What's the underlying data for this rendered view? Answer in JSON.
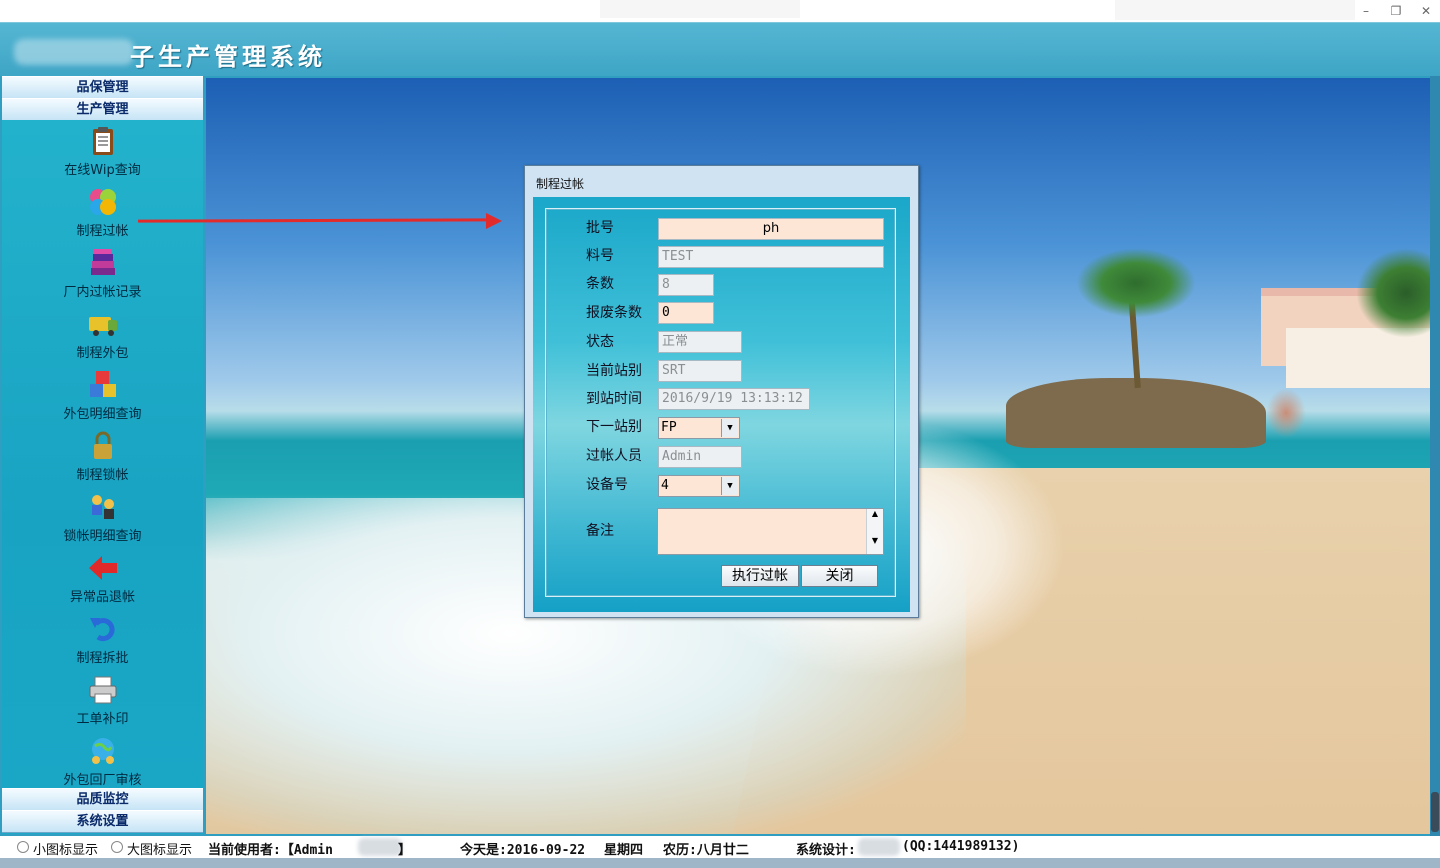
{
  "window": {
    "app_title": "子生产管理系统",
    "minimize": "–",
    "restore": "❐",
    "close": "✕"
  },
  "sidebar": {
    "top_sections": [
      "品保管理",
      "生产管理"
    ],
    "items": [
      {
        "label": "在线Wip查询",
        "icon": "clipboard-icon"
      },
      {
        "label": "制程过帐",
        "icon": "colorful-pinwheel-icon"
      },
      {
        "label": "厂内过帐记录",
        "icon": "books-icon"
      },
      {
        "label": "制程外包",
        "icon": "truck-icon"
      },
      {
        "label": "外包明细查询",
        "icon": "blocks-icon"
      },
      {
        "label": "制程锁帐",
        "icon": "padlock-icon"
      },
      {
        "label": "锁帐明细查询",
        "icon": "lock-users-icon"
      },
      {
        "label": "异常品退帐",
        "icon": "red-left-arrow-icon"
      },
      {
        "label": "制程拆批",
        "icon": "undo-arrow-icon"
      },
      {
        "label": "工单补印",
        "icon": "printer-icon"
      },
      {
        "label": "外包回厂审核",
        "icon": "globe-users-icon"
      }
    ],
    "bottom_sections": [
      "品质监控",
      "系统设置"
    ],
    "scroll_down": "▼"
  },
  "dialog": {
    "title": "制程过帐",
    "fields": {
      "batch": {
        "label": "批号",
        "value": "ph"
      },
      "material": {
        "label": "料号",
        "value": "TEST"
      },
      "count": {
        "label": "条数",
        "value": "8"
      },
      "scrap": {
        "label": "报废条数",
        "value": "0"
      },
      "status": {
        "label": "状态",
        "value": "正常"
      },
      "current_station": {
        "label": "当前站别",
        "value": "SRT"
      },
      "arrival_time": {
        "label": "到站时间",
        "value": "2016/9/19 13:13:12"
      },
      "next_station": {
        "label": "下一站别",
        "value": "FP"
      },
      "operator": {
        "label": "过帐人员",
        "value": "Admin"
      },
      "device": {
        "label": "设备号",
        "value": "4"
      },
      "remark": {
        "label": "备注",
        "value": ""
      }
    },
    "execute_button": "执行过帐",
    "close_button": "关闭"
  },
  "statusbar": {
    "small_icons": "小图标显示",
    "large_icons": "大图标显示",
    "current_user_label": "当前使用者:【Admin",
    "current_user_end": "】",
    "today": "今天是:2016-09-22",
    "weekday": "星期四",
    "lunar": "农历:八月廿二",
    "designer_label": "系统设计:",
    "designer_qq": "(QQ:1441989132)"
  }
}
